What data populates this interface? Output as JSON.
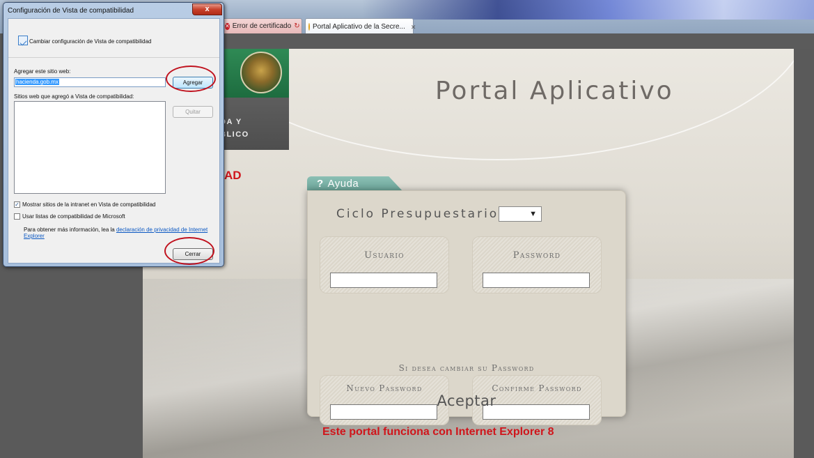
{
  "browser": {
    "tabs": [
      {
        "label": "Error de certificado",
        "state": "error"
      },
      {
        "label": "Portal Aplicativo de la Secre...",
        "state": "active"
      }
    ]
  },
  "page": {
    "header_text_line1": "DA Y",
    "header_text_line2": "BLICO",
    "red_heading": "IDAD",
    "portal_title": "Portal Aplicativo",
    "help_tab_mark": "?",
    "help_tab_label": "Ayuda",
    "ciclo_label": "Ciclo Presupuestario:",
    "usuario_label": "Usuario",
    "password_label": "Password",
    "change_password_note": "Si desea cambiar su Password",
    "nuevo_password_label": "Nuevo Password",
    "confirme_password_label": "Confirme Password",
    "aceptar_label": "Aceptar",
    "ie_note": "Este portal funciona con Internet Explorer 8"
  },
  "dialog": {
    "title": "Configuración de Vista de compatibilidad",
    "close_glyph": "x",
    "header_text": "Cambiar configuración de Vista de compatibilidad",
    "add_site_label": "Agregar este sitio web:",
    "add_site_value": "hacienda.gob.mx",
    "add_button": "Agregar",
    "sites_label": "Sitios web que agregó a Vista de compatibilidad:",
    "remove_button": "Quitar",
    "check_intranet": "Mostrar sitios de la intranet en Vista de compatibilidad",
    "check_intranet_checked": true,
    "check_microsoft": "Usar listas de compatibilidad de Microsoft",
    "check_microsoft_checked": false,
    "info_text": "Para obtener más información, lea la ",
    "info_link": "declaración de privacidad de Internet Explorer",
    "close_button": "Cerrar"
  },
  "colors": {
    "accent_red": "#d0151b",
    "annotation_ring": "#c0121e",
    "help_tab_green": "#6aa498"
  }
}
